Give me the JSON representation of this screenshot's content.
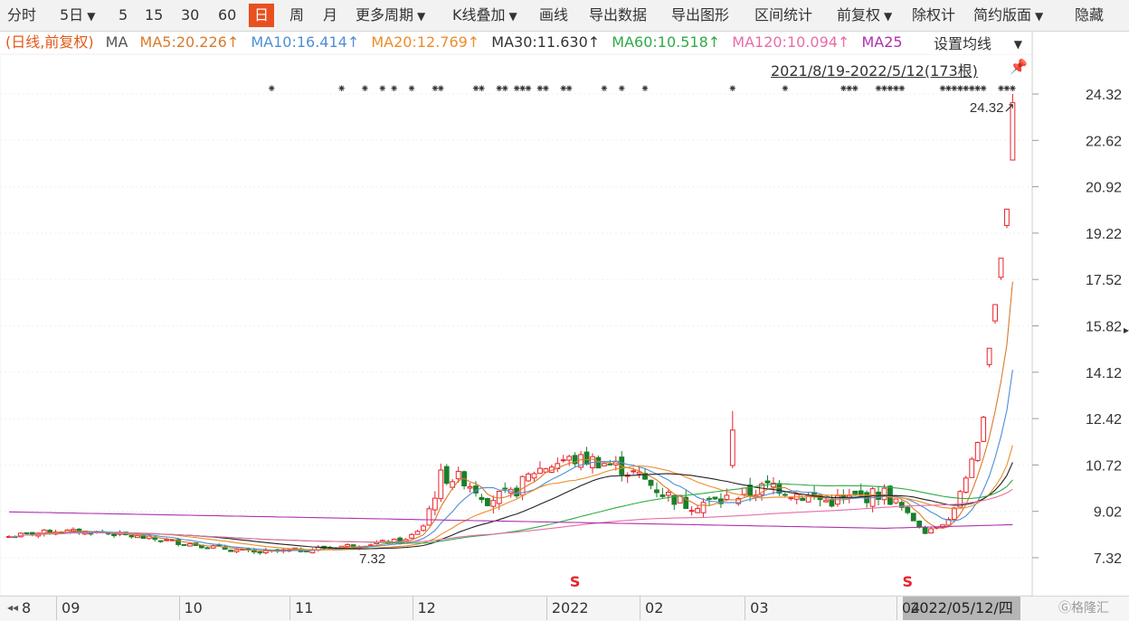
{
  "toolbar": {
    "items": [
      "分时",
      "5日",
      "5",
      "15",
      "30",
      "60",
      "日",
      "周",
      "月",
      "更多周期",
      "K线叠加",
      "画线",
      "导出数据",
      "导出图形",
      "区间统计",
      "前复权",
      "除权计",
      "简约版面",
      "隐藏"
    ],
    "active": "日",
    "caret": "▼"
  },
  "legend": {
    "prefix": "(日线,前复权)",
    "ma_label": "MA",
    "ma5": "MA5:20.226↑",
    "ma10": "MA10:16.414↑",
    "ma20": "MA20:12.769↑",
    "ma30": "MA30:11.630↑",
    "ma60": "MA60:10.518↑",
    "ma120": "MA120:10.094↑",
    "ma250": "MA25",
    "settings_label": "设置均线",
    "range_label": "2021/8/19-2022/5/12(173根)",
    "pin_icon": "pin-icon"
  },
  "colors": {
    "up": "#e8232b",
    "down": "#1a7f2a",
    "ma5": "#d97b2b",
    "ma10": "#4f8fd6",
    "ma20": "#f08c2a",
    "ma30": "#222222",
    "ma60": "#2eab46",
    "ma120": "#e86ca8",
    "ma250": "#b030b0",
    "prefix": "#e05a1a"
  },
  "chart_data": {
    "type": "candlestick",
    "ylim": [
      7.32,
      24.32
    ],
    "y_ticks": [
      "24.32",
      "22.62",
      "20.92",
      "19.22",
      "17.52",
      "15.82",
      "14.12",
      "12.42",
      "10.72",
      "9.02",
      "7.32"
    ],
    "x_labels": [
      "8",
      "09",
      "10",
      "11",
      "12",
      "2022",
      "02",
      "03",
      "04"
    ],
    "x_label_index": [
      0,
      9,
      30,
      49,
      70,
      93,
      109,
      127,
      153
    ],
    "annotations": {
      "max_label": "24.32↗",
      "min_label": "7.32",
      "s_markers": [
        "S",
        "S"
      ],
      "s_index": [
        97,
        154
      ],
      "ellipsis_marker": "◂◂"
    },
    "date_label": "2022/05/12/四",
    "star_positions": [
      45,
      57,
      61,
      64,
      66,
      69,
      73,
      74,
      80,
      81,
      84,
      85,
      87,
      88,
      89,
      91,
      92,
      95,
      96,
      102,
      105,
      109,
      124,
      133,
      143,
      144,
      145,
      149,
      150,
      151,
      152,
      153,
      160,
      161,
      162,
      163,
      164,
      165,
      166,
      167,
      170,
      171,
      172
    ],
    "watermark": "Ⓖ格隆汇"
  }
}
